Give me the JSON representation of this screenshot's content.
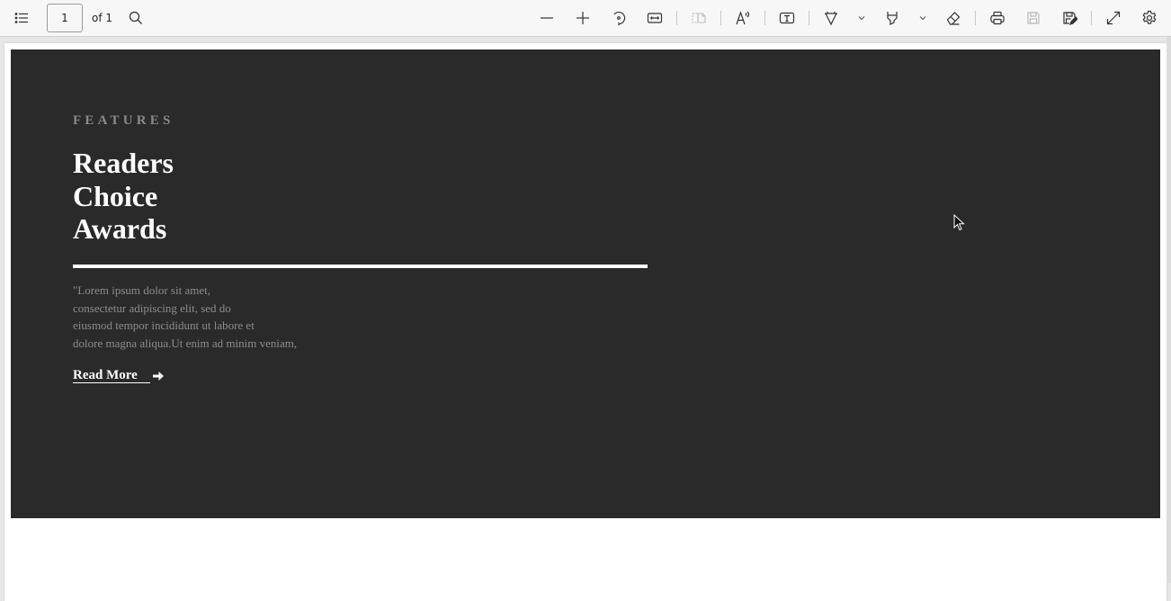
{
  "toolbar": {
    "contents_button": {
      "icon": "table-of-contents-icon",
      "label": "Table of contents"
    },
    "page_number": "1",
    "page_total_label": "of 1",
    "search_button": {
      "icon": "search-icon",
      "label": "Find"
    },
    "zoom_out": {
      "icon": "minus-icon",
      "label": "Zoom out"
    },
    "zoom_in": {
      "icon": "plus-icon",
      "label": "Zoom in"
    },
    "rotate": {
      "icon": "rotate-icon",
      "label": "Rotate"
    },
    "fit_width": {
      "icon": "fit-width-icon",
      "label": "Fit to width"
    },
    "page_view": {
      "icon": "page-view-icon",
      "label": "Page view",
      "disabled": true
    },
    "read_aloud": {
      "icon": "read-aloud-icon",
      "label": "Read aloud"
    },
    "add_text": {
      "icon": "text-box-icon",
      "label": "Add text"
    },
    "draw": {
      "icon": "draw-icon",
      "label": "Draw"
    },
    "highlight": {
      "icon": "highlight-icon",
      "label": "Highlight"
    },
    "erase": {
      "icon": "eraser-icon",
      "label": "Erase"
    },
    "print": {
      "icon": "print-icon",
      "label": "Print"
    },
    "save": {
      "icon": "save-icon",
      "label": "Save",
      "disabled": true
    },
    "save_as": {
      "icon": "save-as-icon",
      "label": "Save as"
    },
    "fullscreen": {
      "icon": "expand-icon",
      "label": "Full screen"
    },
    "settings": {
      "icon": "gear-icon",
      "label": "Settings"
    }
  },
  "document": {
    "eyebrow": "FEATURES",
    "title_lines": [
      "Readers",
      "Choice",
      "Awards"
    ],
    "body_lines": [
      "\"Lorem ipsum dolor sit amet,",
      "consectetur adipiscing elit, sed do",
      "eiusmod tempor incididunt ut labore et",
      "dolore magna aliqua.Ut enim ad minim veniam,"
    ],
    "read_more_label": "Read More",
    "colors": {
      "panel_bg": "#2a2a2a",
      "title": "#ffffff",
      "eyebrow": "#8a8a8a",
      "body": "#8c8c8c"
    }
  }
}
